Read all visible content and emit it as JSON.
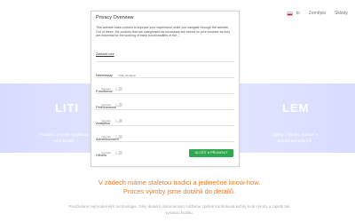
{
  "nav": {
    "lang_label": "to",
    "items": [
      "Zeměpis",
      "Sklady"
    ]
  },
  "hero": {
    "left_title": "LITI",
    "right_title": "LEM",
    "left_sub": "Flexibilní a rychlá výroba na míru kvalitě",
    "right_sub": "Odlitky z hliníku, mosazi a bronzu pro průmysl"
  },
  "headline": "V zádech máme staletou tradici a jedinečné know-how. Proces výroby jsme dotáhli do detailů.",
  "bodytext": "Používáme nejmodernější technologie. Díky detailní dokumentaci můžeme zpětně kontrolovat každý krok výroby a zajistit tak vysokou kvalitu.",
  "modal": {
    "title": "Privacy Overview",
    "description": "This website uses cookies to improve your experience while you navigate through the website. Out of these, the cookies that are categorized as necessary are stored on your browser as they are essential for the working of basic functionalities of the ...",
    "link": "Zobrazit více",
    "categories": [
      {
        "name": "Necessary",
        "badge": "Vždy povoleno",
        "sub": "",
        "necessary": true
      },
      {
        "name": "Functional",
        "badge": "",
        "sub": "Vypnuto",
        "necessary": false
      },
      {
        "name": "Performance",
        "badge": "",
        "sub": "Vypnuto",
        "necessary": false
      },
      {
        "name": "Analytics",
        "badge": "",
        "sub": "Vypnuto",
        "necessary": false
      },
      {
        "name": "Advertisement",
        "badge": "",
        "sub": "Vypnuto",
        "necessary": false
      },
      {
        "name": "Others",
        "badge": "",
        "sub": "Vypnuto",
        "necessary": false
      }
    ],
    "accept_label": "ULOŽIT A PŘIJMOUT"
  },
  "colors": {
    "accent_orange": "#f07a26",
    "hero_bg": "#d8dbff",
    "accept_green": "#2fa84f"
  }
}
